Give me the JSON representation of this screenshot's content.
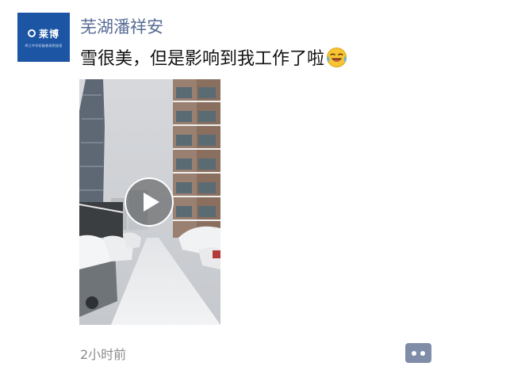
{
  "post": {
    "author": "芜湖潘祥安",
    "text": "雪很美，但是影响到我工作了啦",
    "emoji": "laughing-crying-emoji",
    "timestamp": "2小时前"
  },
  "avatar": {
    "logo_text": "莱博",
    "tagline": "鸠江中学初级普高衔接班",
    "bg_color": "#1b55a3"
  },
  "video": {
    "play_icon": "play-icon"
  },
  "actions": {
    "comment_icon": "comment-icon",
    "color": "#7f8da8"
  },
  "colors": {
    "author": "#576b95",
    "timestamp": "#8c8c8c"
  }
}
